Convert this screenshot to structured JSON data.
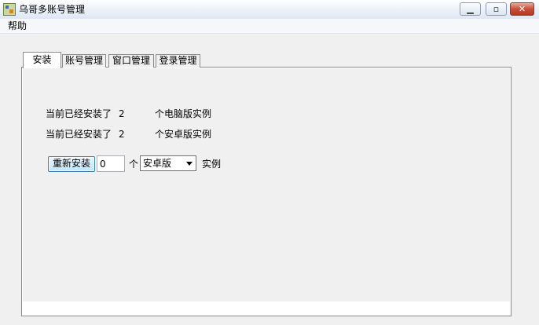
{
  "window": {
    "title": "乌哥多账号管理",
    "buttons": {
      "minimize": "▁",
      "maximize": "▫",
      "close": "✕"
    }
  },
  "menubar": {
    "items": [
      {
        "label": "帮助"
      }
    ]
  },
  "tabs": [
    {
      "label": "安装",
      "active": true
    },
    {
      "label": "账号管理",
      "active": false
    },
    {
      "label": "窗口管理",
      "active": false
    },
    {
      "label": "登录管理",
      "active": false
    }
  ],
  "install": {
    "pc_line": {
      "prefix": "当前已经安装了",
      "count": "2",
      "suffix": "个电脑版实例"
    },
    "android_line": {
      "prefix": "当前已经安装了",
      "count": "2",
      "suffix": "个安卓版实例"
    },
    "reinstall_button": "重新安装",
    "count_value": "0",
    "unit_label": "个",
    "version_select": {
      "selected": "安卓版"
    },
    "instance_label": "实例"
  }
}
